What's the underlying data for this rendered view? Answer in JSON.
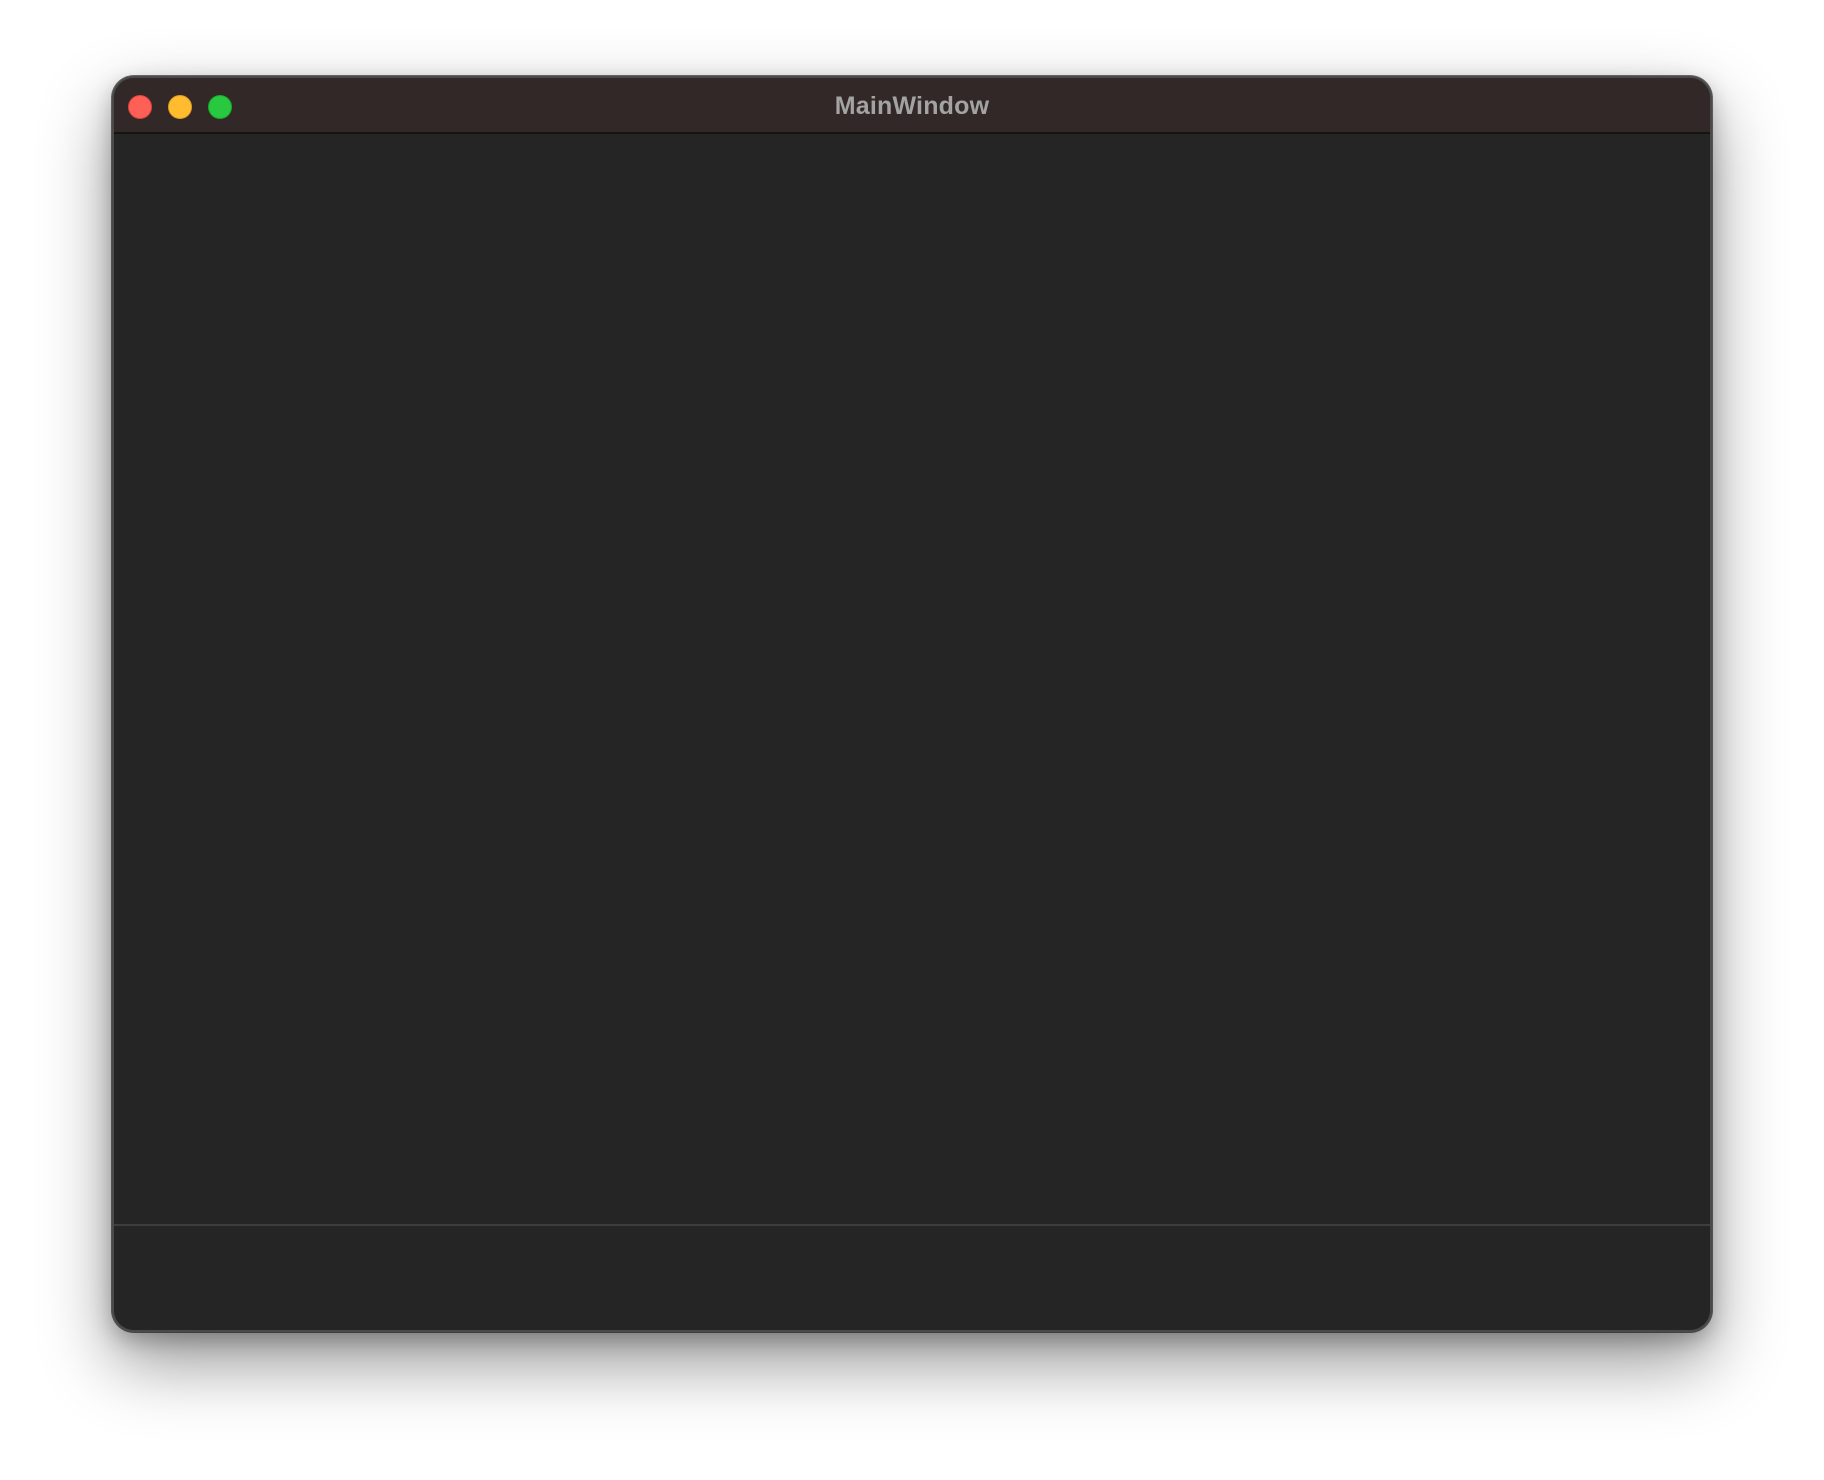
{
  "window": {
    "title": "MainWindow",
    "controls": {
      "close_color": "#fe5f57",
      "minimize_color": "#febc2e",
      "zoom_color": "#28c840"
    },
    "titlebar_color": "#332828",
    "background_color": "#252525"
  }
}
